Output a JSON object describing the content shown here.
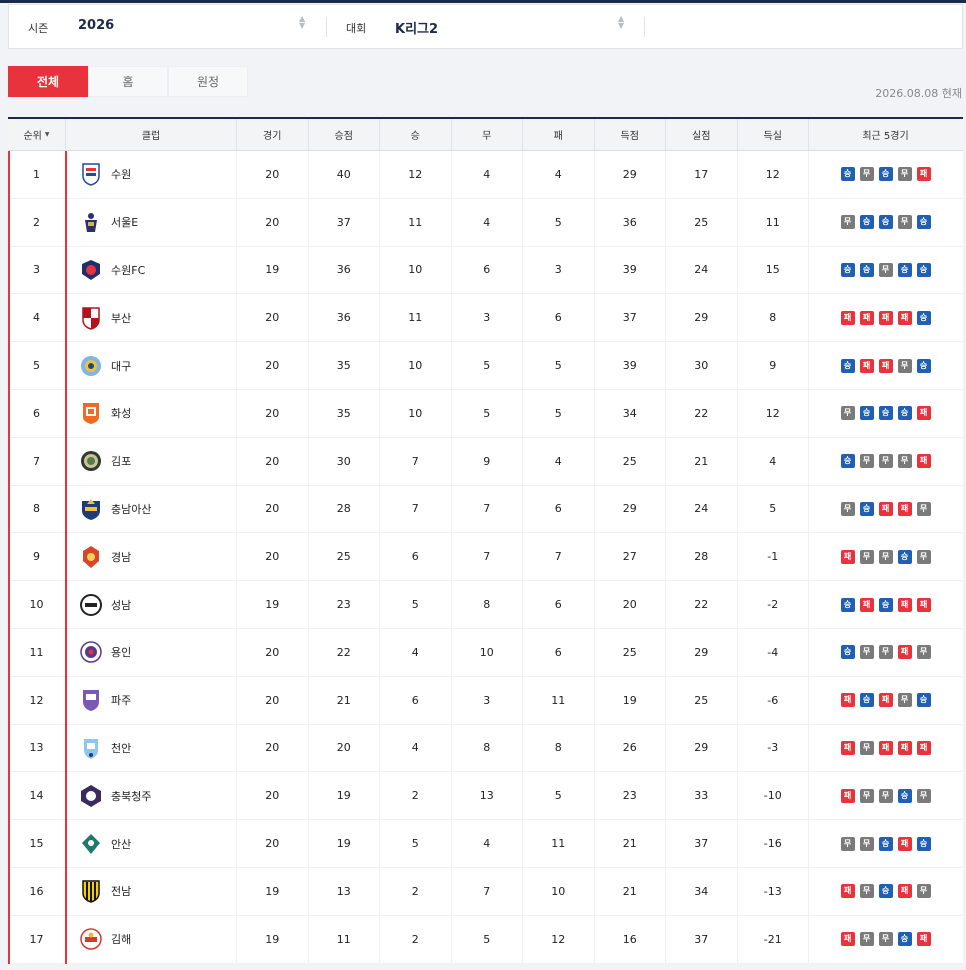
{
  "filter": {
    "season_label": "시즌",
    "season_value": "2026",
    "competition_label": "대회",
    "competition_value": "K리그2"
  },
  "tabs": [
    {
      "label": "전체",
      "active": true
    },
    {
      "label": "홈",
      "active": false
    },
    {
      "label": "원정",
      "active": false
    }
  ],
  "as_of": "2026.08.08 현재",
  "columns": [
    "순위",
    "클럽",
    "경기",
    "승점",
    "승",
    "무",
    "패",
    "득점",
    "실점",
    "득실",
    "최근 5경기"
  ],
  "result_labels": {
    "W": "승",
    "D": "무",
    "L": "패"
  },
  "colors": {
    "accent": "#e8323c",
    "navy": "#1c2a4a",
    "win": "#1f5fb4",
    "draw": "#7a7a7a",
    "loss": "#e8323c"
  },
  "rows": [
    {
      "rank": "1",
      "club": "수원",
      "emblem": "suwon-samsung-emblem",
      "played": "20",
      "points": "40",
      "win": "12",
      "draw": "4",
      "loss": "4",
      "gf": "29",
      "ga": "17",
      "gd": "12",
      "recent": [
        "W",
        "D",
        "W",
        "D",
        "L"
      ]
    },
    {
      "rank": "2",
      "club": "서울E",
      "emblem": "seoul-eland-emblem",
      "played": "20",
      "points": "37",
      "win": "11",
      "draw": "4",
      "loss": "5",
      "gf": "36",
      "ga": "25",
      "gd": "11",
      "recent": [
        "D",
        "W",
        "W",
        "D",
        "W"
      ]
    },
    {
      "rank": "3",
      "club": "수원FC",
      "emblem": "suwon-fc-emblem",
      "played": "19",
      "points": "36",
      "win": "10",
      "draw": "6",
      "loss": "3",
      "gf": "39",
      "ga": "24",
      "gd": "15",
      "recent": [
        "W",
        "W",
        "D",
        "W",
        "W"
      ]
    },
    {
      "rank": "4",
      "club": "부산",
      "emblem": "busan-emblem",
      "played": "20",
      "points": "36",
      "win": "11",
      "draw": "3",
      "loss": "6",
      "gf": "37",
      "ga": "29",
      "gd": "8",
      "recent": [
        "L",
        "L",
        "L",
        "L",
        "W"
      ]
    },
    {
      "rank": "5",
      "club": "대구",
      "emblem": "daegu-emblem",
      "played": "20",
      "points": "35",
      "win": "10",
      "draw": "5",
      "loss": "5",
      "gf": "39",
      "ga": "30",
      "gd": "9",
      "recent": [
        "W",
        "L",
        "L",
        "D",
        "W"
      ]
    },
    {
      "rank": "6",
      "club": "화성",
      "emblem": "hwaseong-emblem",
      "played": "20",
      "points": "35",
      "win": "10",
      "draw": "5",
      "loss": "5",
      "gf": "34",
      "ga": "22",
      "gd": "12",
      "recent": [
        "D",
        "W",
        "W",
        "W",
        "L"
      ]
    },
    {
      "rank": "7",
      "club": "김포",
      "emblem": "gimpo-emblem",
      "played": "20",
      "points": "30",
      "win": "7",
      "draw": "9",
      "loss": "4",
      "gf": "25",
      "ga": "21",
      "gd": "4",
      "recent": [
        "W",
        "D",
        "D",
        "D",
        "L"
      ]
    },
    {
      "rank": "8",
      "club": "충남아산",
      "emblem": "chungnam-asan-emblem",
      "played": "20",
      "points": "28",
      "win": "7",
      "draw": "7",
      "loss": "6",
      "gf": "29",
      "ga": "24",
      "gd": "5",
      "recent": [
        "D",
        "W",
        "L",
        "L",
        "D"
      ]
    },
    {
      "rank": "9",
      "club": "경남",
      "emblem": "gyeongnam-emblem",
      "played": "20",
      "points": "25",
      "win": "6",
      "draw": "7",
      "loss": "7",
      "gf": "27",
      "ga": "28",
      "gd": "-1",
      "recent": [
        "L",
        "D",
        "D",
        "W",
        "D"
      ]
    },
    {
      "rank": "10",
      "club": "성남",
      "emblem": "seongnam-emblem",
      "played": "19",
      "points": "23",
      "win": "5",
      "draw": "8",
      "loss": "6",
      "gf": "20",
      "ga": "22",
      "gd": "-2",
      "recent": [
        "W",
        "L",
        "W",
        "L",
        "L"
      ]
    },
    {
      "rank": "11",
      "club": "용인",
      "emblem": "yongin-emblem",
      "played": "20",
      "points": "22",
      "win": "4",
      "draw": "10",
      "loss": "6",
      "gf": "25",
      "ga": "29",
      "gd": "-4",
      "recent": [
        "W",
        "D",
        "D",
        "L",
        "D"
      ]
    },
    {
      "rank": "12",
      "club": "파주",
      "emblem": "paju-emblem",
      "played": "20",
      "points": "21",
      "win": "6",
      "draw": "3",
      "loss": "11",
      "gf": "19",
      "ga": "25",
      "gd": "-6",
      "recent": [
        "L",
        "W",
        "L",
        "D",
        "W"
      ]
    },
    {
      "rank": "13",
      "club": "천안",
      "emblem": "cheonan-emblem",
      "played": "20",
      "points": "20",
      "win": "4",
      "draw": "8",
      "loss": "8",
      "gf": "26",
      "ga": "29",
      "gd": "-3",
      "recent": [
        "L",
        "D",
        "L",
        "L",
        "L"
      ]
    },
    {
      "rank": "14",
      "club": "충북청주",
      "emblem": "chungbuk-cheongju-emblem",
      "played": "20",
      "points": "19",
      "win": "2",
      "draw": "13",
      "loss": "5",
      "gf": "23",
      "ga": "33",
      "gd": "-10",
      "recent": [
        "L",
        "D",
        "D",
        "W",
        "D"
      ]
    },
    {
      "rank": "15",
      "club": "안산",
      "emblem": "ansan-emblem",
      "played": "20",
      "points": "19",
      "win": "5",
      "draw": "4",
      "loss": "11",
      "gf": "21",
      "ga": "37",
      "gd": "-16",
      "recent": [
        "D",
        "D",
        "W",
        "L",
        "W"
      ]
    },
    {
      "rank": "16",
      "club": "전남",
      "emblem": "jeonnam-emblem",
      "played": "19",
      "points": "13",
      "win": "2",
      "draw": "7",
      "loss": "10",
      "gf": "21",
      "ga": "34",
      "gd": "-13",
      "recent": [
        "L",
        "D",
        "W",
        "L",
        "D"
      ]
    },
    {
      "rank": "17",
      "club": "김해",
      "emblem": "gimhae-emblem",
      "played": "19",
      "points": "11",
      "win": "2",
      "draw": "5",
      "loss": "12",
      "gf": "16",
      "ga": "37",
      "gd": "-21",
      "recent": [
        "L",
        "D",
        "D",
        "W",
        "L"
      ]
    }
  ]
}
